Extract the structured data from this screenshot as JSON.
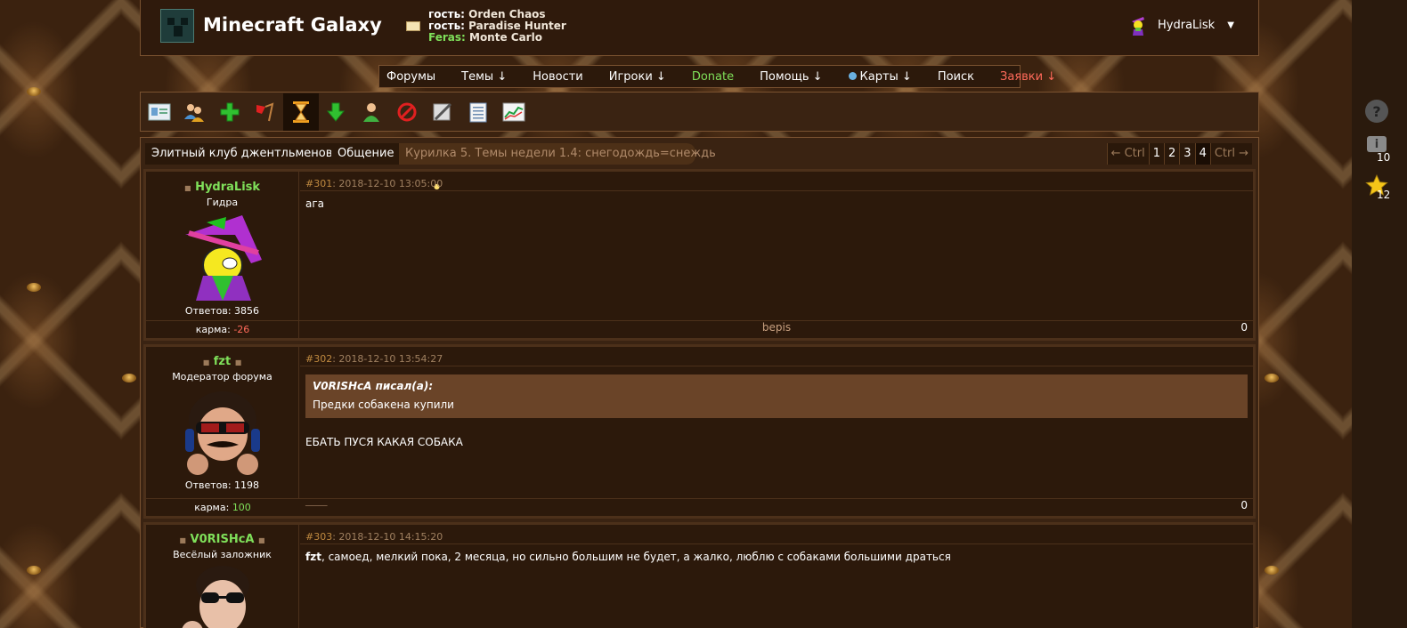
{
  "site": {
    "title": "Minecraft Galaxy",
    "online": [
      {
        "label": "гость:",
        "name": "Orden Chaos"
      },
      {
        "label": "гость:",
        "name": "Paradise Hunter"
      },
      {
        "label": "Feras:",
        "name": "Monte Carlo"
      }
    ],
    "user": {
      "name": "HydraLisk",
      "menu_icon": "chevron-down-icon"
    }
  },
  "nav": {
    "items": [
      "Форумы",
      "Темы ↓",
      "Новости",
      "Игроки ↓",
      "Donate",
      "Помощь ↓",
      "Карты ↓",
      "Поиск",
      "Заявки ↓"
    ]
  },
  "toolbar": {
    "icons": [
      "profile-card-icon",
      "users-icon",
      "add-icon",
      "flag-icon",
      "hourglass-icon",
      "download-icon",
      "user-icon",
      "ban-icon",
      "edit-icon",
      "notes-icon",
      "chart-icon"
    ]
  },
  "rail": {
    "help_icon": "help-icon",
    "info_count": "10",
    "star_count": "12"
  },
  "breadcrumb": {
    "items": [
      "Элитный клуб джентльменов",
      "Общение"
    ],
    "thread": "Курилка 5. Темы недели 1.4: снегодождь=снеждь"
  },
  "pager": {
    "prev": "← Ctrl",
    "pages": [
      "1",
      "2",
      "3",
      "4"
    ],
    "current": "4",
    "next": "Ctrl →"
  },
  "posts": [
    {
      "author": "HydraLisk",
      "role": "Гидра",
      "replies": "Ответов: 3856",
      "karma_label": "карма:",
      "karma": "-26",
      "number": "#301",
      "date": ": 2018-12-10 13:05:00",
      "text": "ага",
      "signature": "bepis",
      "rating": "0"
    },
    {
      "author": "fzt",
      "role": "Модератор форума",
      "replies": "Ответов: 1198",
      "karma_label": "карма:",
      "karma": "100",
      "number": "#302",
      "date": ": 2018-12-10 13:54:27",
      "quote_author": "V0RISHcA писал(а):",
      "quote_text": "Предки собакена купили",
      "text": "ЕБАТЬ ПУСЯ КАКАЯ СОБАКА",
      "signature": "_______",
      "rating": "0"
    },
    {
      "author": "V0RISHcA",
      "role": "Весёлый заложник",
      "number": "#303",
      "date": ": 2018-12-10 14:15:20",
      "mention": "fzt",
      "text": ", самоед, мелкий пока, 2 месяца, но сильно большим не будет, а жалко, люблю с собаками большими драться"
    }
  ]
}
